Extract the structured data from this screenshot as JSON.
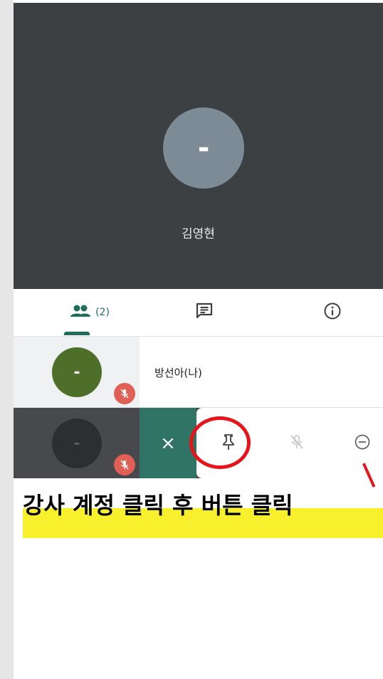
{
  "main_participant": {
    "avatar_letter": "-",
    "name": "김영현"
  },
  "tabs": {
    "people_count": "(2)"
  },
  "participants": [
    {
      "avatar_letter": "-",
      "name": "방선아(나)",
      "muted": true
    },
    {
      "avatar_letter": "-",
      "muted": true
    }
  ],
  "actions": {
    "close_label": "×"
  },
  "instruction_text": "강사 계정 클릭 후 버튼 클릭",
  "colors": {
    "video_bg": "#3c4043",
    "accent": "#1e6d5b",
    "mute_red": "#e06055",
    "highlight_red": "#e8121b",
    "highlight_yellow": "#f9f02d"
  }
}
